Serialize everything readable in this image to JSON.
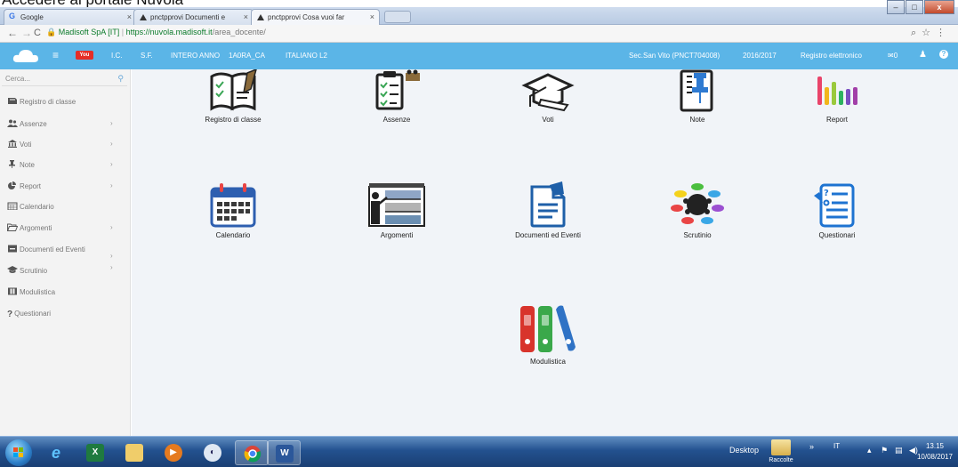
{
  "caption": "Accedere al portale Nuvola",
  "browser": {
    "tabs": [
      {
        "label": "Google"
      },
      {
        "label": "pnctpprovi Documenti e"
      },
      {
        "label": "pnctpprovi Cosa vuoi far"
      }
    ],
    "site_name": "Madisoft SpA [IT]",
    "url_host": "https://nuvola.madisoft.it",
    "url_path": "/area_docente/"
  },
  "header": {
    "links": [
      "I.C.",
      "S.F.",
      "INTERO ANNO",
      "1A0RA_CA",
      "ITALIANO L2"
    ],
    "school": "Sec.San Vito (PNCT704008)",
    "year": "2016/2017",
    "register": "Registro elettronico",
    "mail_count": "0"
  },
  "sidebar": {
    "search_placeholder": "Cerca...",
    "items": [
      {
        "label": "Registro di classe"
      },
      {
        "label": "Assenze"
      },
      {
        "label": "Voti"
      },
      {
        "label": "Note"
      },
      {
        "label": "Report"
      },
      {
        "label": "Calendario"
      },
      {
        "label": "Argomenti"
      },
      {
        "label": "Documenti ed Eventi"
      },
      {
        "label": "Scrutinio"
      },
      {
        "label": "Modulistica"
      },
      {
        "label": "Questionari"
      }
    ]
  },
  "tiles": [
    {
      "label": "Registro di classe"
    },
    {
      "label": "Assenze"
    },
    {
      "label": "Voti"
    },
    {
      "label": "Note"
    },
    {
      "label": "Report"
    },
    {
      "label": "Calendario"
    },
    {
      "label": "Argomenti"
    },
    {
      "label": "Documenti ed Eventi"
    },
    {
      "label": "Scrutinio"
    },
    {
      "label": "Questionari"
    },
    {
      "label": "Modulistica"
    }
  ],
  "taskbar": {
    "desktop_label": "Desktop",
    "folder_label": "Raccolte",
    "lang": "IT",
    "time": "13.15",
    "date": "10/08/2017"
  }
}
